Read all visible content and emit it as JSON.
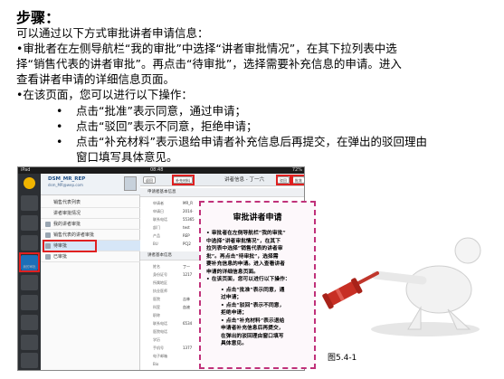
{
  "heading": "步骤：",
  "lines": [
    "可以通过以下方式审批讲者申请信息：",
    "•审批者在左侧导航栏“我的审批”中选择“讲者审批情况”，在其下拉列表中选",
    "择“销售代表的讲者审批”。再点击“待审批”，选择需要补充信息的申请。进入",
    "查看讲者申请的详细信息页面。",
    "•在该页面，您可以进行以下操作："
  ],
  "sub_bullet": "•",
  "sub_items": [
    "点击“批准”表示同意，通过申请；",
    "点击“驳回”表示不同意，拒绝申请；",
    "点击“补充材料”表示退给申请者补充信息后再提交，在弹出的驳回理由",
    "窗口填写具体意见。"
  ],
  "tablet": {
    "status_bar": {
      "left": "iPad",
      "center": "08:48",
      "right": "72%"
    },
    "nav_items": [
      "",
      "",
      "",
      "",
      "我的审批",
      "",
      "",
      "",
      ""
    ],
    "user": {
      "name": "DSM_MR_REP",
      "email": "dsm_MR@wep.com"
    },
    "tree": [
      "销售代表列表",
      "讲者审批情况",
      "我的讲者审批",
      "销售代表的讲者审批",
      "待审批",
      "已审批"
    ],
    "toolbar": {
      "back": "返回",
      "supplement": "补充材料",
      "title": "讲者信息 - 丁一六",
      "reject": "驳回",
      "approve": "批准"
    },
    "sections": [
      "申请者基本信息",
      "讲者基本信息"
    ],
    "applicant_fields": [
      {
        "k": "申请者",
        "v": "MR_R"
      },
      {
        "k": "申请日",
        "v": "2014-"
      },
      {
        "k": "联系电话",
        "v": "55365"
      },
      {
        "k": "部门",
        "v": "test"
      },
      {
        "k": "产品",
        "v": "REP"
      },
      {
        "k": "BU",
        "v": "PCJ2"
      }
    ],
    "speaker_fields": [
      {
        "k": "姓名",
        "v": "丁一"
      },
      {
        "k": "身份证号",
        "v": "1217"
      },
      {
        "k": "所属地区",
        "v": ""
      },
      {
        "k": "执业医师",
        "v": ""
      },
      {
        "k": "医院",
        "v": "吉林"
      },
      {
        "k": "科室",
        "v": "血液"
      },
      {
        "k": "职称",
        "v": ""
      },
      {
        "k": "联系电话",
        "v": "6534"
      },
      {
        "k": "医院电话",
        "v": ""
      },
      {
        "k": "学历",
        "v": ""
      },
      {
        "k": "手机号",
        "v": "1377"
      },
      {
        "k": "电子邮箱",
        "v": ""
      },
      {
        "k": "Bio",
        "v": ""
      }
    ]
  },
  "popup": {
    "title": "审批讲者申请",
    "lines": [
      "• 审批者在左侧导航栏“我的审批”",
      "中选择“讲者审批情况”，在其下",
      "拉列表中选择“销售代表的讲者审",
      "批”。再点击“待审批”，选择需",
      "要补充信息的申请。进入查看讲者",
      "申请的详细信息页面。",
      "• 在该页面，您可以进行以下操作："
    ],
    "sub_lines": [
      "• 点击“批准”表示同意，通",
      "过申请；",
      "• 点击“驳回”表示不同意，",
      "拒绝申请；",
      "• 点击“补充材料”表示退给",
      "申请者补充信息后再提交，",
      "在弹出的驳回理由窗口填写",
      "具体意见。"
    ]
  },
  "caption": "图5.4-1",
  "colors": {
    "highlight_red": "#e02020",
    "popup_border": "#c0317a",
    "nav_dark": "#2c2f33",
    "nav_active": "#1c6fb8"
  }
}
